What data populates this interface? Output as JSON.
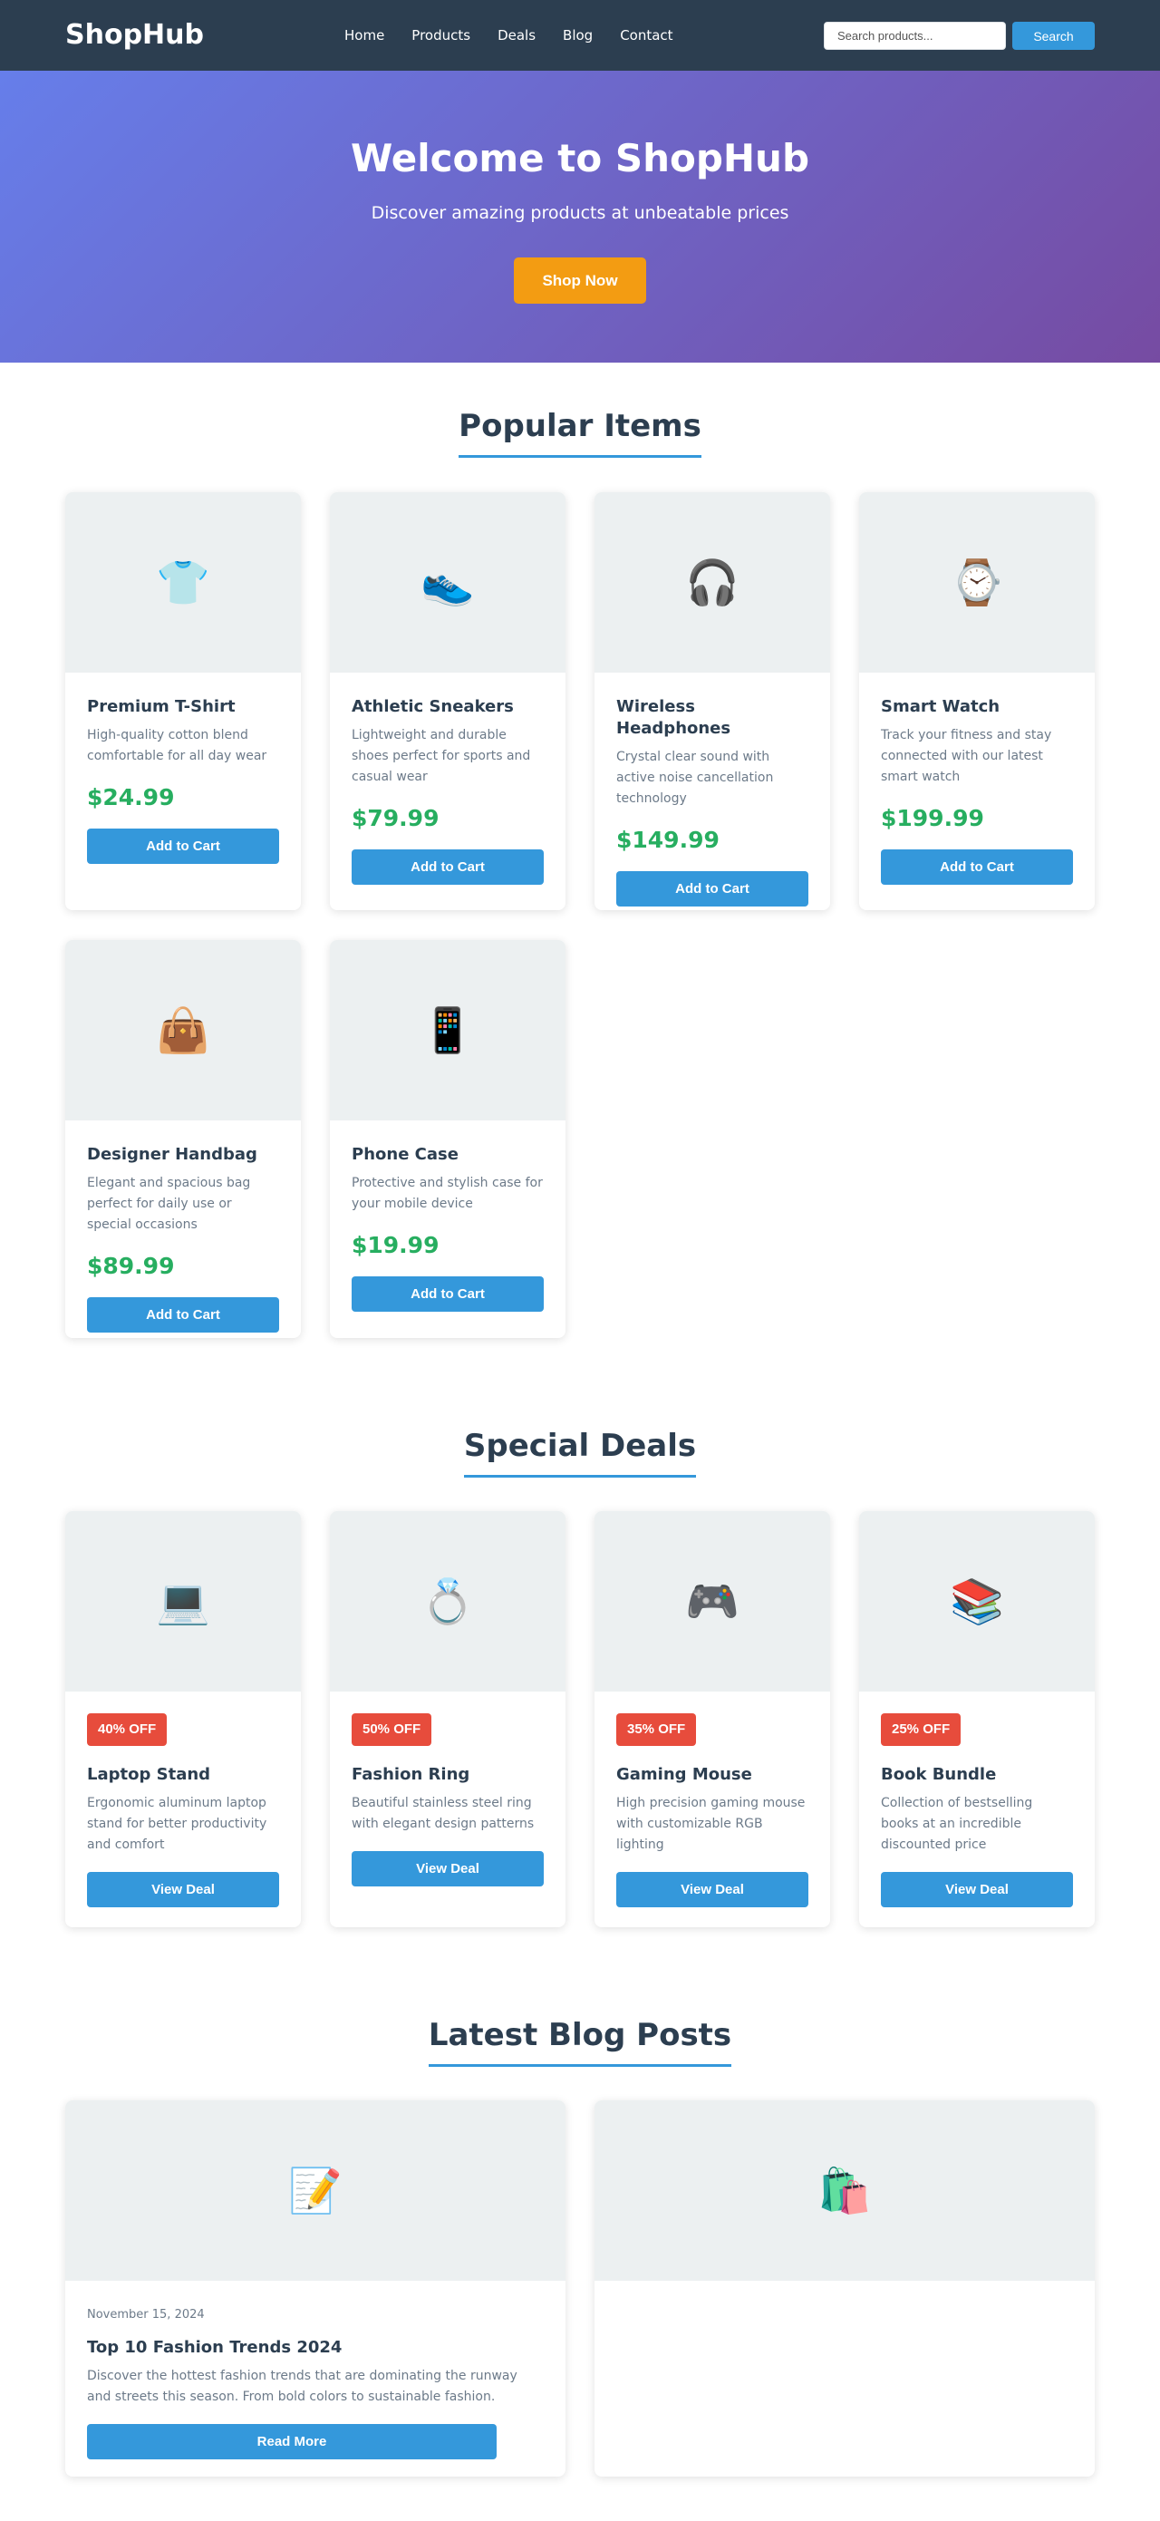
{
  "header": {
    "logo": "ShopHub",
    "nav": [
      "Home",
      "Products",
      "Deals",
      "Blog",
      "Contact"
    ],
    "search_placeholder": "Search products...",
    "search_button": "Search"
  },
  "hero": {
    "title": "Welcome to ShopHub",
    "subtitle": "Discover amazing products at unbeatable prices",
    "cta": "Shop Now"
  },
  "popular": {
    "title": "Popular Items",
    "items": [
      {
        "icon": "t-shirt-icon",
        "emoji": "👕",
        "name": "Premium T-Shirt",
        "desc": "High-quality cotton blend comfortable for all day wear",
        "price": "$24.99",
        "button": "Add to Cart"
      },
      {
        "icon": "sneaker-icon",
        "emoji": "👟",
        "name": "Athletic Sneakers",
        "desc": "Lightweight and durable shoes perfect for sports and casual wear",
        "price": "$79.99",
        "button": "Add to Cart"
      },
      {
        "icon": "headphones-icon",
        "emoji": "🎧",
        "name": "Wireless Headphones",
        "desc": "Crystal clear sound with active noise cancellation technology",
        "price": "$149.99",
        "button": "Add to Cart"
      },
      {
        "icon": "watch-icon",
        "emoji": "⌚",
        "name": "Smart Watch",
        "desc": "Track your fitness and stay connected with our latest smart watch",
        "price": "$199.99",
        "button": "Add to Cart"
      },
      {
        "icon": "handbag-icon",
        "emoji": "👜",
        "name": "Designer Handbag",
        "desc": "Elegant and spacious bag perfect for daily use or special occasions",
        "price": "$89.99",
        "button": "Add to Cart"
      },
      {
        "icon": "phone-icon",
        "emoji": "📱",
        "name": "Phone Case",
        "desc": "Protective and stylish case for your mobile device",
        "price": "$19.99",
        "button": "Add to Cart"
      }
    ]
  },
  "deals": {
    "title": "Special Deals",
    "items": [
      {
        "icon": "laptop-icon",
        "emoji": "💻",
        "badge": "40% OFF",
        "name": "Laptop Stand",
        "desc": "Ergonomic aluminum laptop stand for better productivity and comfort",
        "button": "View Deal"
      },
      {
        "icon": "ring-icon",
        "emoji": "💍",
        "badge": "50% OFF",
        "name": "Fashion Ring",
        "desc": "Beautiful stainless steel ring with elegant design patterns",
        "button": "View Deal"
      },
      {
        "icon": "gamepad-icon",
        "emoji": "🎮",
        "badge": "35% OFF",
        "name": "Gaming Mouse",
        "desc": "High precision gaming mouse with customizable RGB lighting",
        "button": "View Deal"
      },
      {
        "icon": "books-icon",
        "emoji": "📚",
        "badge": "25% OFF",
        "name": "Book Bundle",
        "desc": "Collection of bestselling books at an incredible discounted price",
        "button": "View Deal"
      }
    ]
  },
  "blog": {
    "title": "Latest Blog Posts",
    "posts": [
      {
        "icon": "memo-icon",
        "emoji": "📝",
        "date": "November 15, 2024",
        "title": "Top 10 Fashion Trends 2024",
        "excerpt": "Discover the hottest fashion trends that are dominating the runway and streets this season. From bold colors to sustainable fashion.",
        "button": "Read More"
      },
      {
        "icon": "shopping-bags-icon",
        "emoji": "🛍️"
      }
    ]
  },
  "colors": {
    "header_bg": "#2c3e50",
    "accent": "#3498db",
    "cta": "#f39c12",
    "price": "#27ae60",
    "badge": "#e74c3c",
    "hero_gradient": [
      "#667eea",
      "#764ba2"
    ]
  }
}
